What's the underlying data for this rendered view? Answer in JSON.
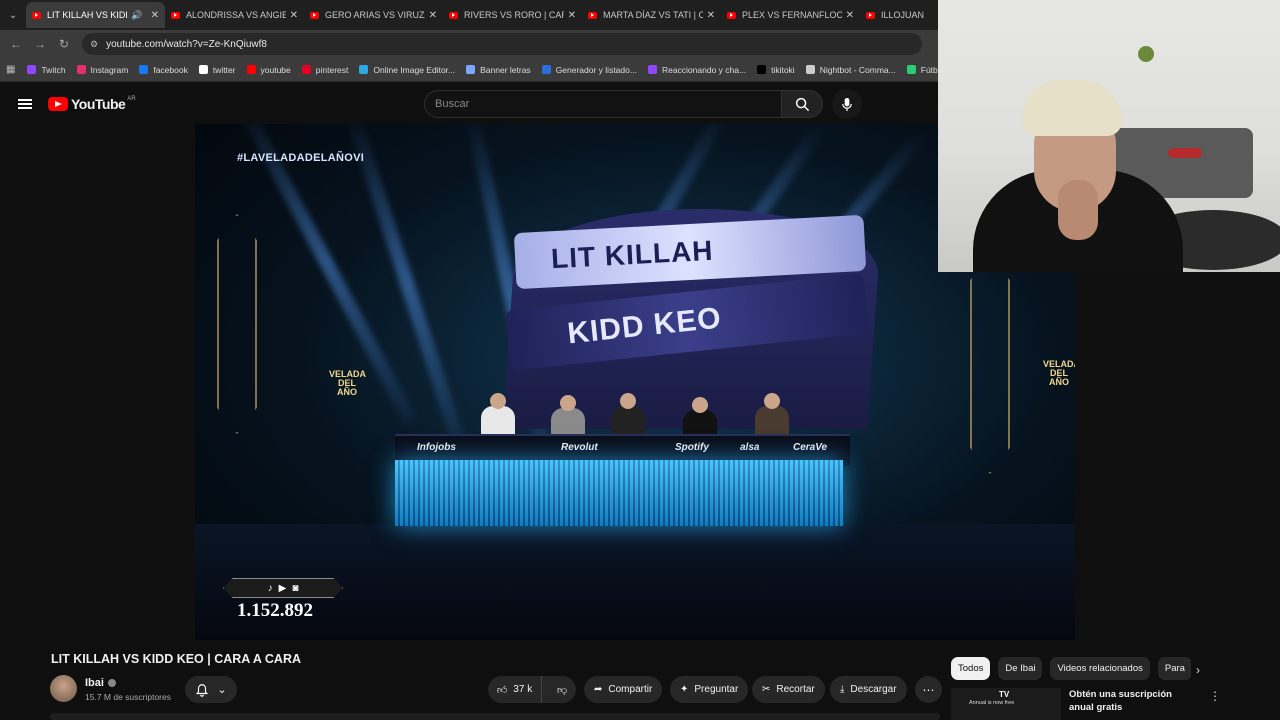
{
  "browser": {
    "tabs": [
      {
        "title": "LIT KILLAH VS KIDD K",
        "active": true
      },
      {
        "title": "ALONDRISSA VS ANGIE V"
      },
      {
        "title": "GERO ARIAS VS VIRUZZ |"
      },
      {
        "title": "RIVERS VS RORO | CARA"
      },
      {
        "title": "MARTA DÍAZ VS TATI | CA"
      },
      {
        "title": "PLEX VS FERNANFLOO | C"
      },
      {
        "title": "ILLOJUAN VS TH"
      }
    ],
    "url": "youtube.com/watch?v=Ze-KnQiuwf8",
    "bookmarks": [
      {
        "label": "Twitch",
        "color": "#9146ff"
      },
      {
        "label": "Instagram",
        "color": "#e1306c"
      },
      {
        "label": "facebook",
        "color": "#1877f2"
      },
      {
        "label": "twitter",
        "color": "#ffffff"
      },
      {
        "label": "youtube",
        "color": "#ff0000"
      },
      {
        "label": "pinterest",
        "color": "#e60023"
      },
      {
        "label": "Online Image Editor...",
        "color": "#2ea8e0"
      },
      {
        "label": "Banner letras",
        "color": "#7aa7ff"
      },
      {
        "label": "Generador y listado...",
        "color": "#2a6fdb"
      },
      {
        "label": "Reaccionando y cha...",
        "color": "#9146ff"
      },
      {
        "label": "tikitoki",
        "color": "#000000"
      },
      {
        "label": "Nightbot - Comma...",
        "color": "#cccccc"
      },
      {
        "label": "Fútbol p",
        "color": "#2ecc71"
      }
    ]
  },
  "youtube": {
    "logo_text": "YouTube",
    "region": "AR",
    "search_placeholder": "Buscar"
  },
  "video": {
    "hashtag": "#LAVELADADELAÑOVI",
    "banner_top": "LIT KILLAH",
    "banner_bottom": "KIDD KEO",
    "velada_logo": "VELADA DEL AÑO",
    "sponsors": [
      "Infojobs",
      "Revolut",
      "Spotify",
      "alsa",
      "CeraVe"
    ],
    "viewer_count": "1.152.892",
    "title": "LIT KILLAH VS KIDD KEO | CARA A CARA"
  },
  "channel": {
    "name": "Ibai",
    "subscribers": "15.7 M de suscriptores"
  },
  "actions": {
    "likes": "37 k",
    "share": "Compartir",
    "ask": "Preguntar",
    "clip": "Recortar",
    "download": "Descargar"
  },
  "sidebar": {
    "chips": [
      "Todos",
      "De Ibai",
      "Videos relacionados",
      "Para"
    ],
    "ad": {
      "title": "Obtén una suscripción anual gratis",
      "thumb_text": "Annual\nis now free"
    }
  }
}
